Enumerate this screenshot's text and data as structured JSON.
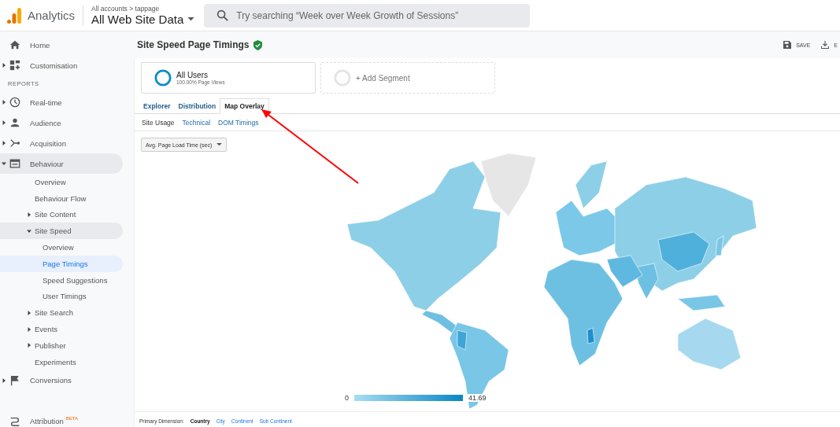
{
  "header": {
    "product": "Analytics",
    "breadcrumb": "All accounts > tappage",
    "property": "All Web Site Data",
    "search": {
      "placeholder": "Try searching “Week over Week Growth of Sessions”"
    }
  },
  "sidebar": {
    "top_items": [
      {
        "label": "Home",
        "expandable": false,
        "expanded": false
      },
      {
        "label": "Customisation",
        "expandable": true,
        "expanded": false
      }
    ],
    "section_label": "REPORTS",
    "report_items": [
      {
        "label": "Real-time",
        "expandable": true,
        "expanded": false
      },
      {
        "label": "Audience",
        "expandable": true,
        "expanded": false
      },
      {
        "label": "Acquisition",
        "expandable": true,
        "expanded": false
      },
      {
        "label": "Behaviour",
        "expandable": true,
        "expanded": true,
        "children": [
          {
            "label": "Overview",
            "expandable": false,
            "expanded": false,
            "selected": false
          },
          {
            "label": "Behaviour Flow",
            "expandable": false,
            "expanded": false,
            "selected": false
          },
          {
            "label": "Site Content",
            "expandable": true,
            "expanded": false,
            "selected": false
          },
          {
            "label": "Site Speed",
            "expandable": true,
            "expanded": true,
            "selected": false,
            "children": [
              {
                "label": "Overview",
                "selected": false
              },
              {
                "label": "Page Timings",
                "selected": true
              },
              {
                "label": "Speed Suggestions",
                "selected": false
              },
              {
                "label": "User Timings",
                "selected": false
              }
            ]
          },
          {
            "label": "Site Search",
            "expandable": true,
            "expanded": false,
            "selected": false
          },
          {
            "label": "Events",
            "expandable": true,
            "expanded": false,
            "selected": false
          },
          {
            "label": "Publisher",
            "expandable": true,
            "expanded": false,
            "selected": false
          },
          {
            "label": "Experiments",
            "expandable": false,
            "expanded": false,
            "selected": false
          }
        ]
      },
      {
        "label": "Conversions",
        "expandable": true,
        "expanded": false
      }
    ],
    "bottom_item": {
      "label": "Attribution",
      "badge": "BETA"
    }
  },
  "report": {
    "title": "Site Speed Page Timings",
    "verified": true,
    "actions": [
      {
        "label": "SAVE"
      },
      {
        "label": "E"
      }
    ]
  },
  "segments": [
    {
      "name": "All Users",
      "detail": "100.00% Page Views",
      "kind": "active"
    },
    {
      "name": "+ Add Segment",
      "kind": "empty"
    }
  ],
  "tabs": [
    {
      "label": "Explorer",
      "selected": false
    },
    {
      "label": "Distribution",
      "selected": false
    },
    {
      "label": "Map Overlay",
      "selected": true
    }
  ],
  "subtabs": [
    {
      "label": "Site Usage",
      "selected": true
    },
    {
      "label": "Technical",
      "selected": false
    },
    {
      "label": "DOM Timings",
      "selected": false
    }
  ],
  "metric_dropdown": "Avg. Page Load Time (sec)",
  "map": {
    "kind": "picture",
    "legend_min": "0",
    "legend_max": "41.69"
  },
  "primary_dimension": {
    "label": "Primary Dimension:",
    "options": [
      {
        "label": "Country",
        "selected": true
      },
      {
        "label": "City",
        "selected": false
      },
      {
        "label": "Continent",
        "selected": false
      },
      {
        "label": "Sub Continent",
        "selected": false
      }
    ]
  }
}
